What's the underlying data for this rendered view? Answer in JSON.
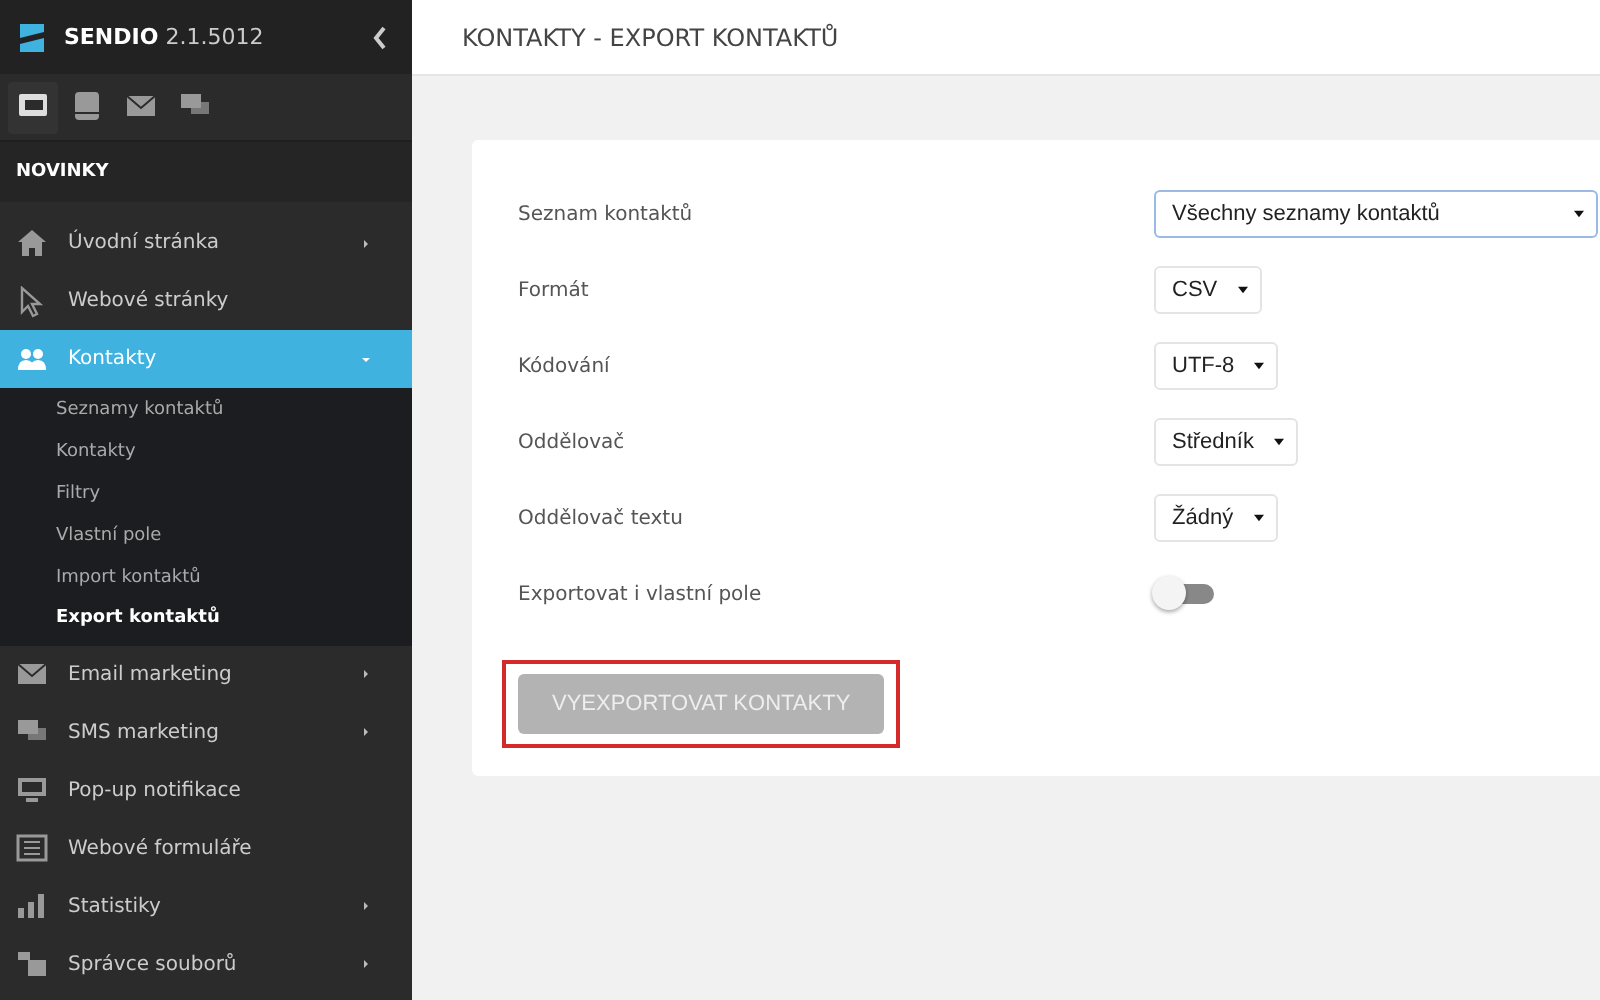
{
  "app": {
    "name": "SENDIO",
    "version": "2.1.5012"
  },
  "sidebar": {
    "tabs": [
      {
        "selected": true
      },
      {
        "selected": false
      },
      {
        "selected": false
      },
      {
        "selected": false
      }
    ],
    "section": "NOVINKY",
    "items": [
      {
        "label": "Úvodní stránka",
        "arrow": true,
        "selected": false
      },
      {
        "label": "Webové stránky",
        "arrow": false,
        "selected": false
      },
      {
        "label": "Kontakty",
        "arrow": true,
        "selected": true,
        "expanded": true,
        "children": [
          {
            "label": "Seznamy kontaktů",
            "selected": false
          },
          {
            "label": "Kontakty",
            "selected": false
          },
          {
            "label": "Filtry",
            "selected": false
          },
          {
            "label": "Vlastní pole",
            "selected": false
          },
          {
            "label": "Import kontaktů",
            "selected": false
          },
          {
            "label": "Export kontaktů",
            "selected": true
          }
        ]
      },
      {
        "label": "Email marketing",
        "arrow": true,
        "selected": false
      },
      {
        "label": "SMS marketing",
        "arrow": true,
        "selected": false
      },
      {
        "label": "Pop-up notifikace",
        "arrow": false,
        "selected": false
      },
      {
        "label": "Webové formuláře",
        "arrow": false,
        "selected": false
      },
      {
        "label": "Statistiky",
        "arrow": true,
        "selected": false
      },
      {
        "label": "Správce souborů",
        "arrow": true,
        "selected": false
      }
    ]
  },
  "page_title": "KONTAKTY - EXPORT KONTAKTŮ",
  "form": {
    "fields": [
      {
        "kind": "select",
        "label": "Seznam kontaktů",
        "value": "Všechny seznamy kontaktů",
        "focused": true
      },
      {
        "kind": "select",
        "label": "Formát",
        "value": "CSV",
        "focused": false
      },
      {
        "kind": "select",
        "label": "Kódování",
        "value": "UTF-8",
        "focused": false
      },
      {
        "kind": "select",
        "label": "Oddělovač",
        "value": "Středník",
        "focused": false
      },
      {
        "kind": "select",
        "label": "Oddělovač textu",
        "value": "Žádný",
        "focused": false
      },
      {
        "kind": "toggle",
        "label": "Exportovat i vlastní pole",
        "on": false
      }
    ],
    "button": {
      "label": "VYEXPORTOVAT KONTAKTY",
      "disabled": true,
      "highlighted": true
    }
  }
}
